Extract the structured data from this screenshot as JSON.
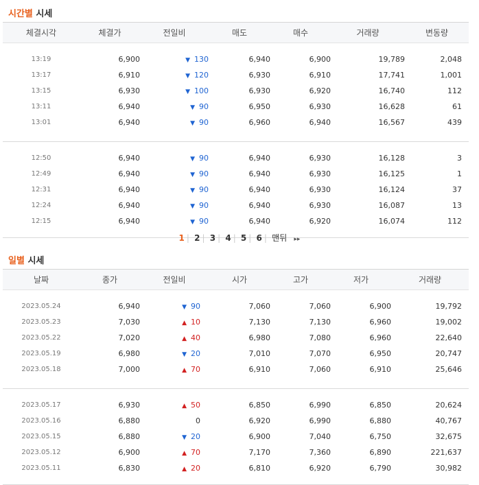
{
  "time_section": {
    "title_highlight": "시간별",
    "title_rest": " 시세",
    "headers": [
      "체결시각",
      "체결가",
      "전일비",
      "매도",
      "매수",
      "거래량",
      "변동량"
    ],
    "rows": [
      {
        "time": "13:19",
        "price": "6,900",
        "dir": "down",
        "change": "130",
        "ask": "6,940",
        "bid": "6,900",
        "volume": "19,789",
        "delta": "2,048"
      },
      {
        "time": "13:17",
        "price": "6,910",
        "dir": "down",
        "change": "120",
        "ask": "6,930",
        "bid": "6,910",
        "volume": "17,741",
        "delta": "1,001"
      },
      {
        "time": "13:15",
        "price": "6,930",
        "dir": "down",
        "change": "100",
        "ask": "6,930",
        "bid": "6,920",
        "volume": "16,740",
        "delta": "112"
      },
      {
        "time": "13:11",
        "price": "6,940",
        "dir": "down",
        "change": "90",
        "ask": "6,950",
        "bid": "6,930",
        "volume": "16,628",
        "delta": "61"
      },
      {
        "time": "13:01",
        "price": "6,940",
        "dir": "down",
        "change": "90",
        "ask": "6,960",
        "bid": "6,940",
        "volume": "16,567",
        "delta": "439"
      },
      {
        "time": "12:50",
        "price": "6,940",
        "dir": "down",
        "change": "90",
        "ask": "6,940",
        "bid": "6,930",
        "volume": "16,128",
        "delta": "3"
      },
      {
        "time": "12:49",
        "price": "6,940",
        "dir": "down",
        "change": "90",
        "ask": "6,940",
        "bid": "6,930",
        "volume": "16,125",
        "delta": "1"
      },
      {
        "time": "12:31",
        "price": "6,940",
        "dir": "down",
        "change": "90",
        "ask": "6,940",
        "bid": "6,930",
        "volume": "16,124",
        "delta": "37"
      },
      {
        "time": "12:24",
        "price": "6,940",
        "dir": "down",
        "change": "90",
        "ask": "6,940",
        "bid": "6,930",
        "volume": "16,087",
        "delta": "13"
      },
      {
        "time": "12:15",
        "price": "6,940",
        "dir": "down",
        "change": "90",
        "ask": "6,940",
        "bid": "6,920",
        "volume": "16,074",
        "delta": "112"
      }
    ]
  },
  "pagination": {
    "pages": [
      "1",
      "2",
      "3",
      "4",
      "5",
      "6"
    ],
    "current": "1",
    "last_label": "맨뒤",
    "next_label": "▸▸"
  },
  "daily_section": {
    "title_highlight": "일별",
    "title_rest": " 시세",
    "headers": [
      "날짜",
      "종가",
      "전일비",
      "시가",
      "고가",
      "저가",
      "거래량"
    ],
    "rows": [
      {
        "date": "2023.05.24",
        "close": "6,940",
        "dir": "down",
        "change": "90",
        "open": "7,060",
        "high": "7,060",
        "low": "6,900",
        "volume": "19,792"
      },
      {
        "date": "2023.05.23",
        "close": "7,030",
        "dir": "up",
        "change": "10",
        "open": "7,130",
        "high": "7,130",
        "low": "6,960",
        "volume": "19,002"
      },
      {
        "date": "2023.05.22",
        "close": "7,020",
        "dir": "up",
        "change": "40",
        "open": "6,980",
        "high": "7,080",
        "low": "6,960",
        "volume": "22,640"
      },
      {
        "date": "2023.05.19",
        "close": "6,980",
        "dir": "down",
        "change": "20",
        "open": "7,010",
        "high": "7,070",
        "low": "6,950",
        "volume": "20,747"
      },
      {
        "date": "2023.05.18",
        "close": "7,000",
        "dir": "up",
        "change": "70",
        "open": "6,910",
        "high": "7,060",
        "low": "6,910",
        "volume": "25,646"
      },
      {
        "date": "2023.05.17",
        "close": "6,930",
        "dir": "up",
        "change": "50",
        "open": "6,850",
        "high": "6,990",
        "low": "6,850",
        "volume": "20,624"
      },
      {
        "date": "2023.05.16",
        "close": "6,880",
        "dir": "flat",
        "change": "0",
        "open": "6,920",
        "high": "6,990",
        "low": "6,880",
        "volume": "40,767"
      },
      {
        "date": "2023.05.15",
        "close": "6,880",
        "dir": "down",
        "change": "20",
        "open": "6,900",
        "high": "7,040",
        "low": "6,750",
        "volume": "32,675"
      },
      {
        "date": "2023.05.12",
        "close": "6,900",
        "dir": "up",
        "change": "70",
        "open": "7,170",
        "high": "7,360",
        "low": "6,890",
        "volume": "221,637"
      },
      {
        "date": "2023.05.11",
        "close": "6,830",
        "dir": "up",
        "change": "20",
        "open": "6,810",
        "high": "6,920",
        "low": "6,790",
        "volume": "30,982"
      }
    ]
  },
  "colors": {
    "accent": "#e8601d",
    "down": "#1f64d2",
    "up": "#d22020"
  }
}
